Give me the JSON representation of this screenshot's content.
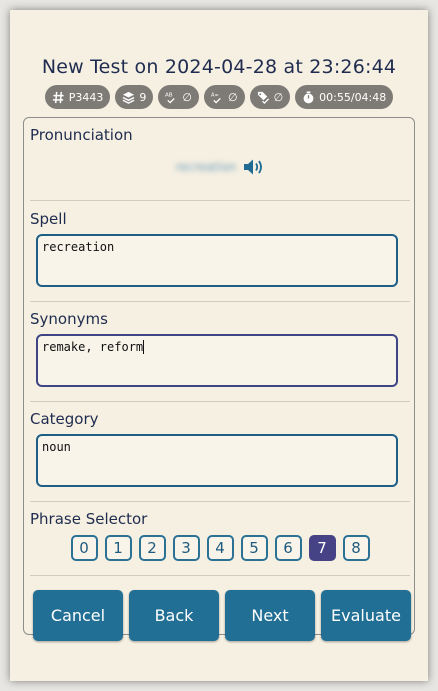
{
  "header": {
    "title": "New Test on 2024-04-28 at 23:26:44",
    "badges": [
      {
        "icon": "hash-icon",
        "text": "P3443"
      },
      {
        "icon": "layers-icon",
        "text": "9"
      },
      {
        "icon": "spell-check-icon",
        "text": "∅"
      },
      {
        "icon": "synonym-check-icon",
        "text": "∅"
      },
      {
        "icon": "tag-check-icon",
        "text": "∅"
      },
      {
        "icon": "timer-icon",
        "text": "00:55/04:48"
      }
    ]
  },
  "pronunciation": {
    "label": "Pronunciation",
    "word": "recreation",
    "speaker_icon": "speaker-icon"
  },
  "spell": {
    "label": "Spell",
    "value": "recreation"
  },
  "synonyms": {
    "label": "Synonyms",
    "value": "remake, reform"
  },
  "category": {
    "label": "Category",
    "value": "noun"
  },
  "phrase_selector": {
    "label": "Phrase Selector",
    "options": [
      "0",
      "1",
      "2",
      "3",
      "4",
      "5",
      "6",
      "7",
      "8"
    ],
    "selected": "7"
  },
  "actions": {
    "cancel": "Cancel",
    "back": "Back",
    "next": "Next",
    "evaluate": "Evaluate"
  },
  "colors": {
    "accent": "#226f95",
    "selected": "#454386",
    "badge": "#7e7b76",
    "background": "#f6f0e2"
  }
}
